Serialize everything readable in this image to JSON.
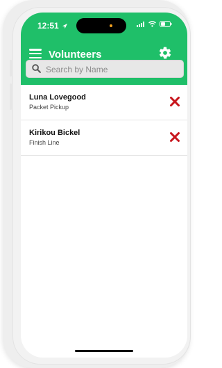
{
  "status_bar": {
    "time": "12:51"
  },
  "header": {
    "title": "Volunteers"
  },
  "search": {
    "placeholder": "Search by Name",
    "value": ""
  },
  "volunteers": [
    {
      "name": "Luna Lovegood",
      "role": "Packet Pickup"
    },
    {
      "name": "Kirikou Bickel",
      "role": "Finish Line"
    }
  ],
  "colors": {
    "accent": "#1fbf69",
    "delete": "#c8161d"
  },
  "icons": [
    "menu-icon",
    "gear-icon",
    "search-icon",
    "delete-icon",
    "location-arrow-icon",
    "signal-icon",
    "wifi-icon",
    "battery-icon"
  ]
}
